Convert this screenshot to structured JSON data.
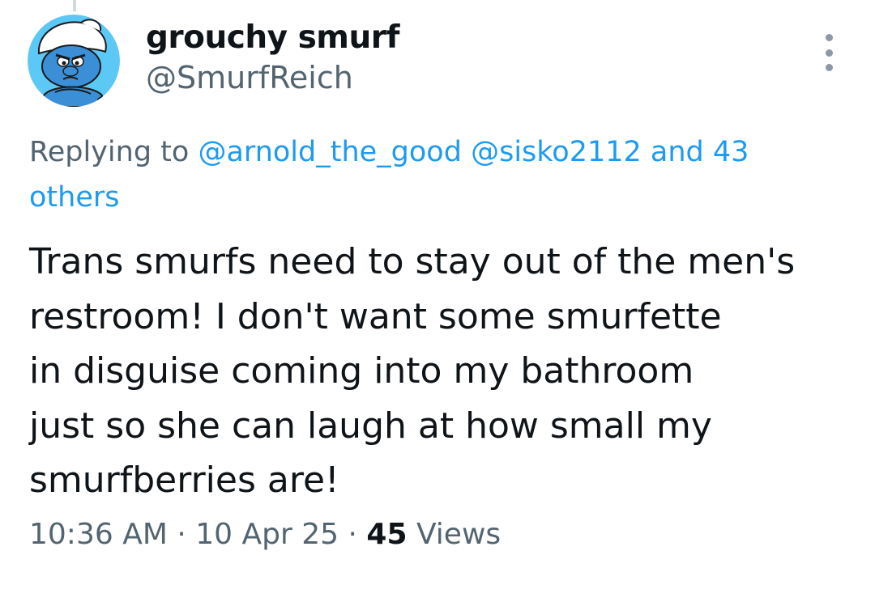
{
  "tweet": {
    "author": {
      "display_name": "grouchy smurf",
      "handle": "@SmurfReich",
      "avatar_icon": "grouchy-smurf-avatar"
    },
    "more_icon": "more-vertical-icon",
    "reply_context": {
      "prefix": "Replying to",
      "mention_1": "@arnold_the_good",
      "mention_2": "@sisko2112",
      "others": "and 43 others"
    },
    "text_lines": [
      "Trans smurfs need to stay out of the men's",
      "restroom! I don't want some smurfette",
      "in disguise coming into my bathroom",
      "just so she can laugh at how small my",
      "smurfberries are!"
    ],
    "meta": {
      "time": "10:36 AM",
      "date": "10 Apr 25",
      "separator": "·",
      "views_count": "45",
      "views_label": "Views"
    }
  },
  "colors": {
    "text_primary": "#0f1419",
    "text_secondary": "#536471",
    "link": "#1d9bf0",
    "avatar_background": "#5bc8f5",
    "smurf_skin": "#3b8fd6"
  }
}
